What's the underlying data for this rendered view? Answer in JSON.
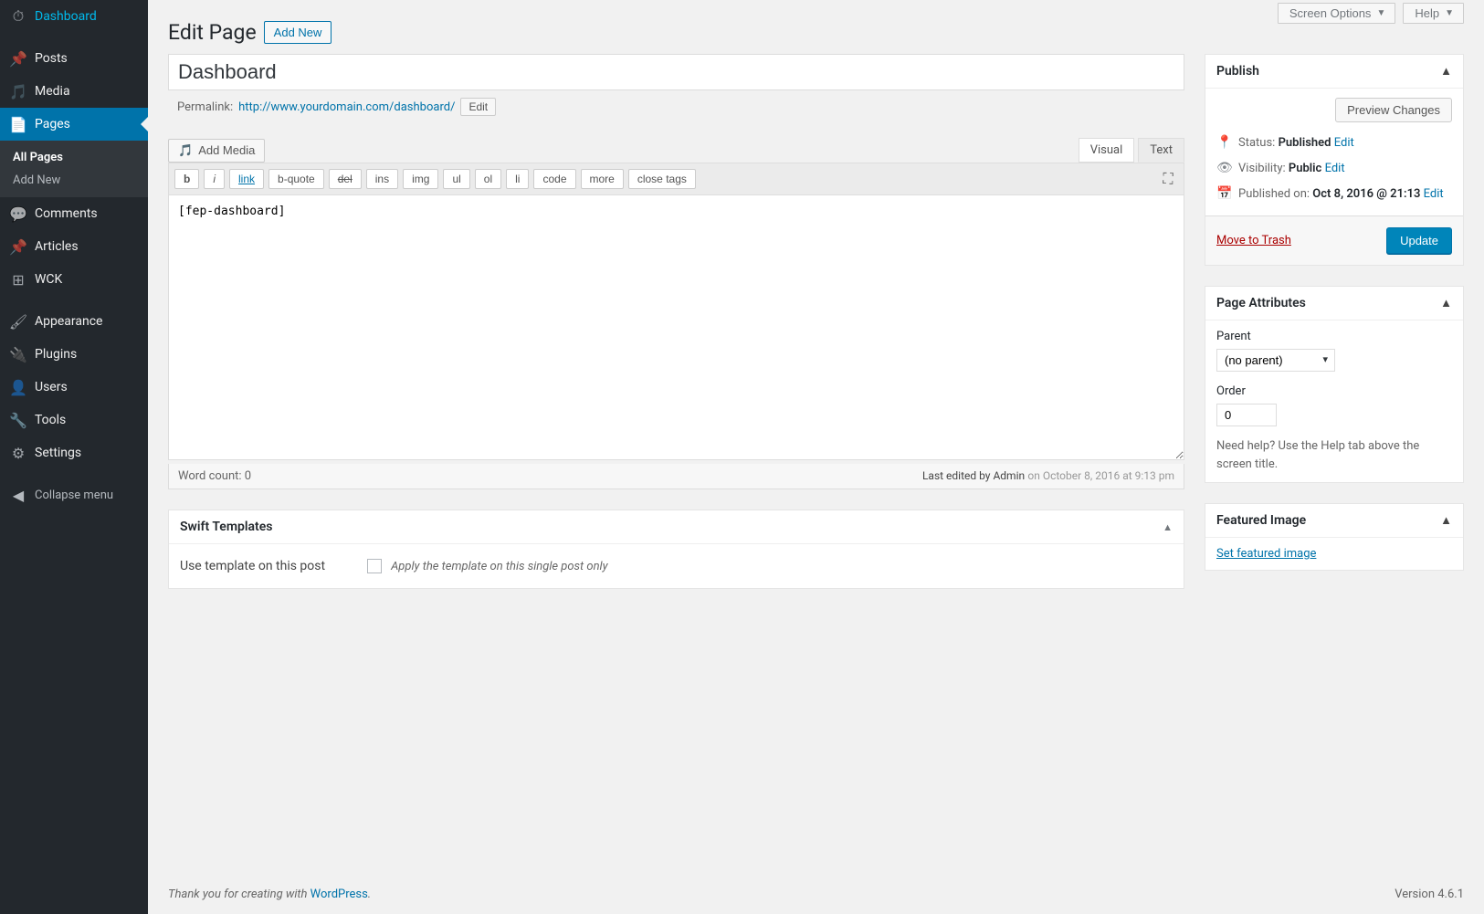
{
  "sidebar": {
    "items": [
      {
        "icon": "dashboard",
        "label": "Dashboard"
      },
      {
        "icon": "pin",
        "label": "Posts"
      },
      {
        "icon": "media",
        "label": "Media"
      },
      {
        "icon": "page",
        "label": "Pages",
        "active": true
      },
      {
        "icon": "comment",
        "label": "Comments"
      },
      {
        "icon": "pin",
        "label": "Articles"
      },
      {
        "icon": "wck",
        "label": "WCK"
      },
      {
        "icon": "brush",
        "label": "Appearance"
      },
      {
        "icon": "plugin",
        "label": "Plugins"
      },
      {
        "icon": "user",
        "label": "Users"
      },
      {
        "icon": "wrench",
        "label": "Tools"
      },
      {
        "icon": "settings",
        "label": "Settings"
      }
    ],
    "sub": {
      "all": "All Pages",
      "add": "Add New"
    },
    "collapse": "Collapse menu"
  },
  "topbar": {
    "screen_options": "Screen Options",
    "help": "Help"
  },
  "heading": {
    "title": "Edit Page",
    "add_new": "Add New"
  },
  "title_field": "Dashboard",
  "permalink": {
    "label": "Permalink:",
    "url": "http://www.yourdomain.com/dashboard/",
    "edit": "Edit"
  },
  "editor": {
    "add_media": "Add Media",
    "tabs": {
      "visual": "Visual",
      "text": "Text"
    },
    "qt": [
      "b",
      "i",
      "link",
      "b-quote",
      "del",
      "ins",
      "img",
      "ul",
      "ol",
      "li",
      "code",
      "more",
      "close tags"
    ],
    "content": "[fep-dashboard]",
    "wordcount_label": "Word count:",
    "wordcount": "0",
    "lastedit_label": "Last edited by Admin",
    "lastedit_time": "on October 8, 2016 at 9:13 pm"
  },
  "swift": {
    "title": "Swift Templates",
    "row_label": "Use template on this post",
    "chk_label": "Apply the template on this single post only"
  },
  "publish": {
    "title": "Publish",
    "preview": "Preview Changes",
    "status_label": "Status:",
    "status_value": "Published",
    "status_edit": "Edit",
    "vis_label": "Visibility:",
    "vis_value": "Public",
    "vis_edit": "Edit",
    "pub_label": "Published on:",
    "pub_value": "Oct 8, 2016 @ 21:13",
    "pub_edit": "Edit",
    "trash": "Move to Trash",
    "update": "Update"
  },
  "page_attr": {
    "title": "Page Attributes",
    "parent_label": "Parent",
    "parent_value": "(no parent)",
    "order_label": "Order",
    "order_value": "0",
    "help": "Need help? Use the Help tab above the screen title."
  },
  "featured": {
    "title": "Featured Image",
    "link": "Set featured image"
  },
  "footer": {
    "thanks": "Thank you for creating with ",
    "wp": "WordPress",
    "dot": ".",
    "version": "Version 4.6.1"
  }
}
